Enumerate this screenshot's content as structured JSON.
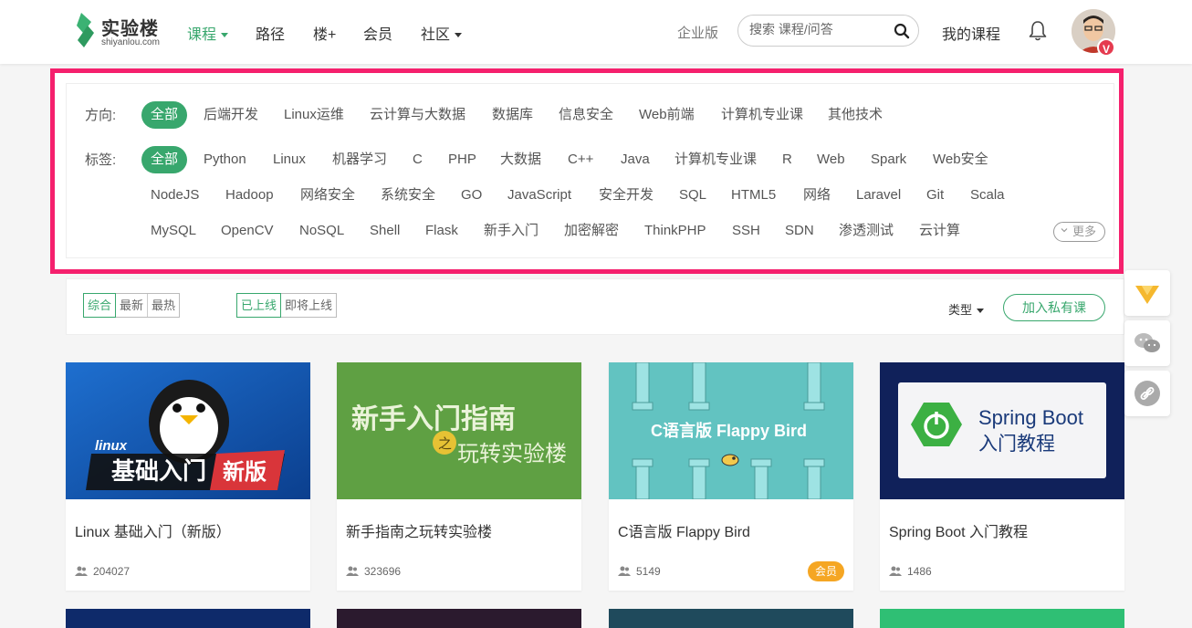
{
  "header": {
    "logo_text": "实验楼",
    "logo_sub": "shiyanlou.com",
    "nav": [
      {
        "label": "课程",
        "active": true,
        "dropdown": true
      },
      {
        "label": "路径",
        "active": false,
        "dropdown": false
      },
      {
        "label": "楼+",
        "active": false,
        "dropdown": false
      },
      {
        "label": "会员",
        "active": false,
        "dropdown": false
      },
      {
        "label": "社区",
        "active": false,
        "dropdown": true
      }
    ],
    "enterprise": "企业版",
    "search_placeholder": "搜索 课程/问答",
    "my_courses": "我的课程",
    "vip_badge": "V"
  },
  "filters": {
    "direction_label": "方向:",
    "directions": [
      "全部",
      "后端开发",
      "Linux运维",
      "云计算与大数据",
      "数据库",
      "信息安全",
      "Web前端",
      "计算机专业课",
      "其他技术"
    ],
    "tags_label": "标签:",
    "tags_row1": [
      "全部",
      "Python",
      "Linux",
      "机器学习",
      "C",
      "PHP",
      "大数据",
      "C++",
      "Java",
      "计算机专业课",
      "R",
      "Web",
      "Spark",
      "Web安全"
    ],
    "tags_row2": [
      "NodeJS",
      "Hadoop",
      "网络安全",
      "系统安全",
      "GO",
      "JavaScript",
      "安全开发",
      "SQL",
      "HTML5",
      "网络",
      "Laravel",
      "Git",
      "Scala"
    ],
    "tags_row3": [
      "MySQL",
      "OpenCV",
      "NoSQL",
      "Shell",
      "Flask",
      "新手入门",
      "加密解密",
      "ThinkPHP",
      "SSH",
      "SDN",
      "渗透测试",
      "云计算"
    ],
    "more": "更多",
    "highlight_color": "#f5206d"
  },
  "sortbar": {
    "order": [
      "综合",
      "最新",
      "最热"
    ],
    "status": [
      "已上线",
      "即将上线"
    ],
    "type": "类型",
    "join_private": "加入私有课"
  },
  "courses": [
    {
      "title": "Linux 基础入门（新版）",
      "users": "204027",
      "thumb_line1": "linux",
      "thumb_line2": "基础入门",
      "thumb_tag": "新版"
    },
    {
      "title": "新手指南之玩转实验楼",
      "users": "323696",
      "thumb_line1": "新手入门指南",
      "thumb_mid": "之",
      "thumb_line2": "玩转实验楼"
    },
    {
      "title": "C语言版 Flappy Bird",
      "users": "5149",
      "badge": "会员",
      "thumb_line1": "C语言版 Flappy Bird"
    },
    {
      "title": "Spring Boot 入门教程",
      "users": "1486",
      "thumb_line1": "Spring Boot",
      "thumb_line2": "入门教程"
    }
  ],
  "colors": {
    "brand_green": "#38a76d",
    "member_badge": "#f5a623"
  }
}
